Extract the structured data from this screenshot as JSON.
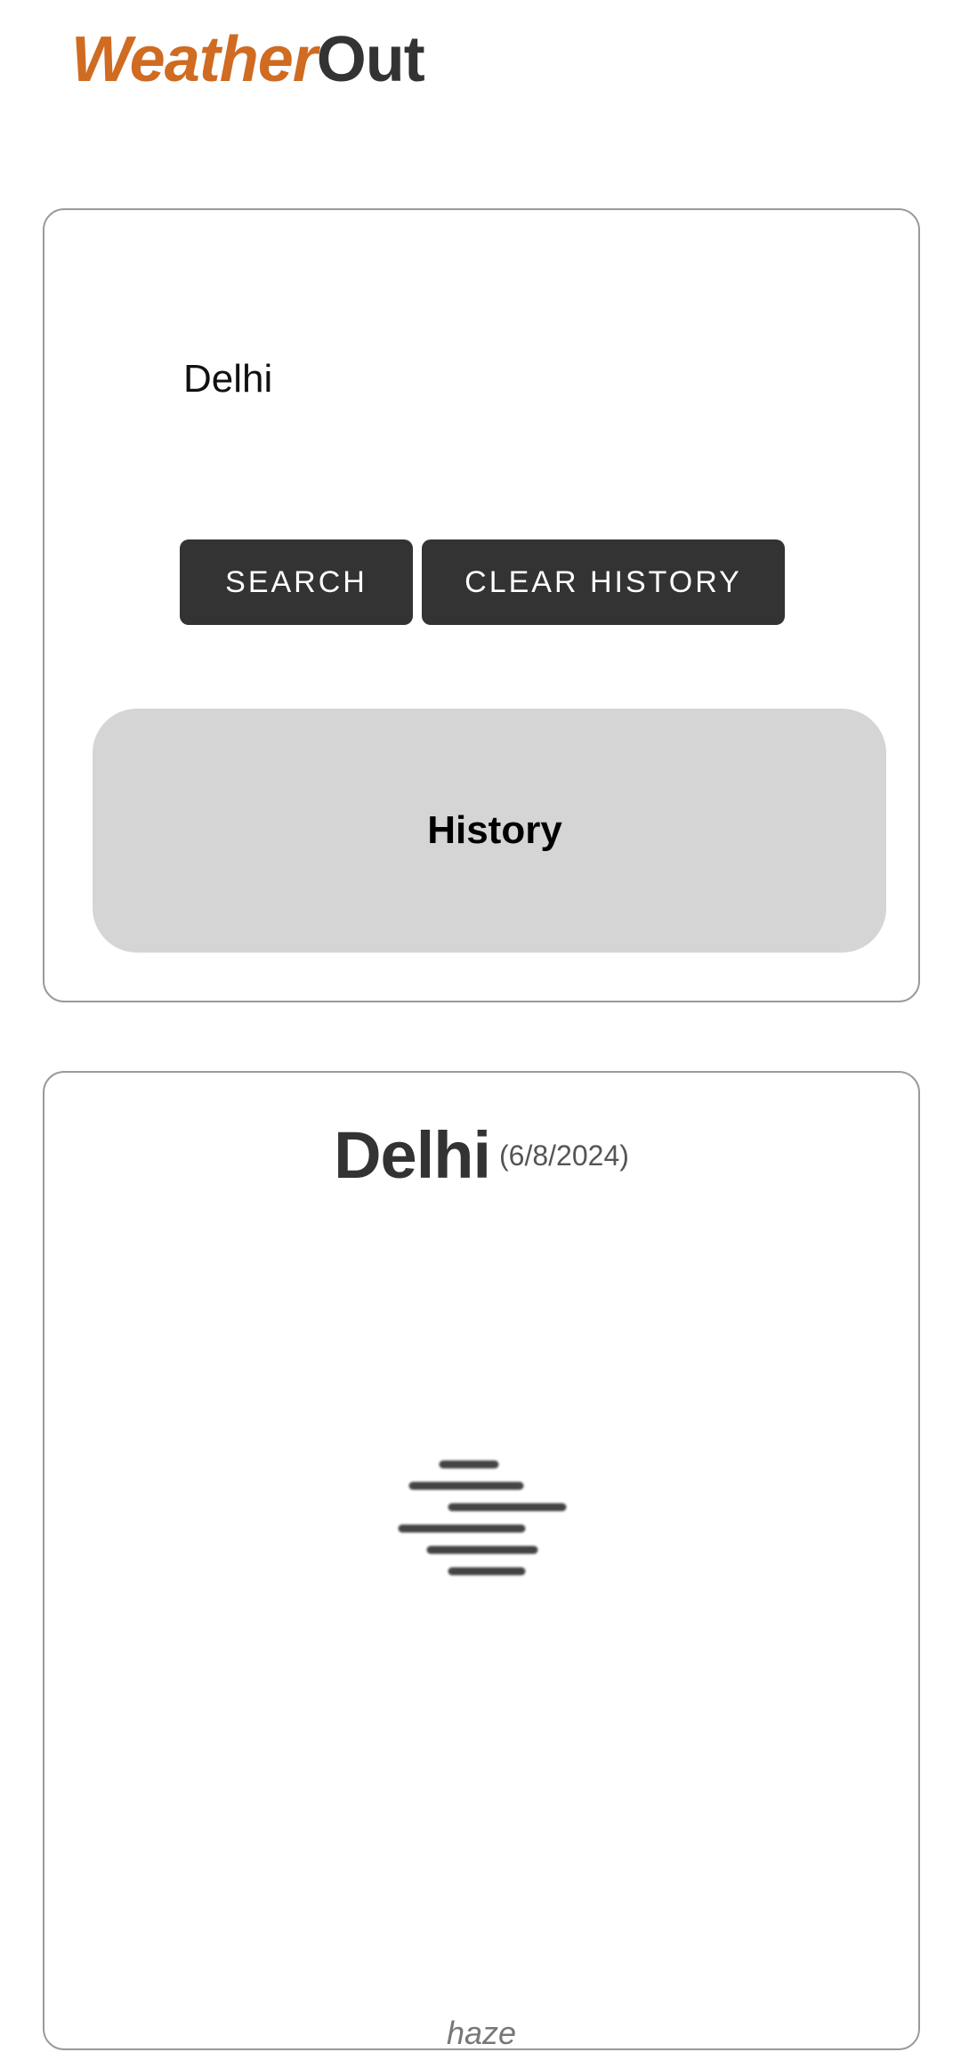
{
  "app": {
    "logo_part1": "Weather",
    "logo_part2": "Out"
  },
  "search": {
    "input_value": "Delhi",
    "search_label": "SEARCH",
    "clear_label": "CLEAR HISTORY",
    "history_title": "History"
  },
  "weather": {
    "city": "Delhi",
    "date": "(6/8/2024)",
    "condition": "haze",
    "icon": "haze-icon"
  },
  "colors": {
    "brand_accent": "#d06b22",
    "dark": "#333333",
    "history_bg": "#d6d5d6"
  }
}
